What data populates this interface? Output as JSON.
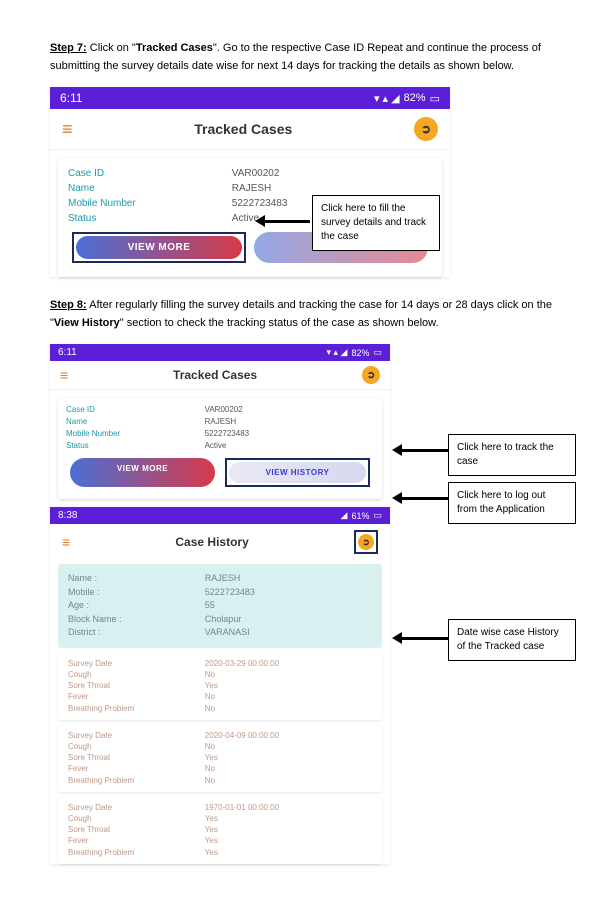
{
  "step7": {
    "label": "Step 7:",
    "text1": " Click on \"",
    "bold1": "Tracked Cases",
    "text2": "\". Go to the respective Case ID Repeat and continue the process of submitting the survey details date wise for next 14 days for tracking the details as shown below."
  },
  "step8": {
    "label": "Step 8:",
    "text1": " After regularly filling the survey details and tracking the case for 14 days or 28 days click on the \"",
    "bold1": "View History",
    "text2": "\" section to check the tracking status of the case as shown below."
  },
  "phone1": {
    "time": "6:11",
    "battery": "82%",
    "title": "Tracked Cases",
    "case": {
      "id_lbl": "Case ID",
      "id_val": "VAR00202",
      "name_lbl": "Name",
      "name_val": "RAJESH",
      "mob_lbl": "Mobile Number",
      "mob_val": "5222723483",
      "status_lbl": "Status",
      "status_val": "Active"
    },
    "btn_vm": "VIEW MORE",
    "callout": "Click here to fill the survey details and track the case"
  },
  "phone2": {
    "time": "6:11",
    "battery": "82%",
    "title": "Tracked Cases",
    "case": {
      "id_lbl": "Case ID",
      "id_val": "VAR00202",
      "name_lbl": "Name",
      "name_val": "RAJESH",
      "mob_lbl": "Mobile Number",
      "mob_val": "5222723483",
      "status_lbl": "Status",
      "status_val": "Active"
    },
    "btn_vm": "VIEW MORE",
    "btn_vh": "VIEW HISTORY",
    "callout_vh": "Click here to track the case",
    "history_time": "8:38",
    "history_battery": "61%",
    "history_title": "Case History",
    "callout_logout": "Click here to log out from the Application",
    "patient": {
      "name_lbl": "Name :",
      "name_val": "RAJESH",
      "mob_lbl": "Mobile :",
      "mob_val": "5222723483",
      "age_lbl": "Age :",
      "age_val": "55",
      "block_lbl": "Block Name :",
      "block_val": "Cholapur",
      "dist_lbl": "District :",
      "dist_val": "VARANASI"
    },
    "surveys": [
      {
        "date_lbl": "Survey Date",
        "date_val": "2020-03-29 00:00:00",
        "cough_lbl": "Cough",
        "cough_val": "No",
        "st_lbl": "Sore Throat",
        "st_val": "Yes",
        "fv_lbl": "Fever",
        "fv_val": "No",
        "bp_lbl": "Breathing Problem",
        "bp_val": "No"
      },
      {
        "date_lbl": "Survey Date",
        "date_val": "2020-04-09 00:00:00",
        "cough_lbl": "Cough",
        "cough_val": "No",
        "st_lbl": "Sore Throat",
        "st_val": "Yes",
        "fv_lbl": "Fever",
        "fv_val": "No",
        "bp_lbl": "Breathing Problem",
        "bp_val": "No"
      },
      {
        "date_lbl": "Survey Date",
        "date_val": "1970-01-01 00:00:00",
        "cough_lbl": "Cough",
        "cough_val": "Yes",
        "st_lbl": "Sore Throat",
        "st_val": "Yes",
        "fv_lbl": "Fever",
        "fv_val": "Yes",
        "bp_lbl": "Breathing Problem",
        "bp_val": "Yes"
      }
    ],
    "callout_hist": "Date wise case History of the Tracked case"
  }
}
